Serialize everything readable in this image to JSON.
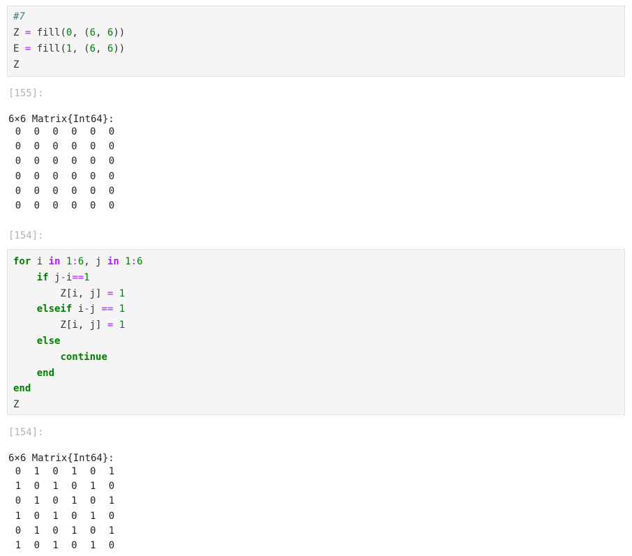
{
  "cells": [
    {
      "code_lines": [
        [
          {
            "t": "#7",
            "c": "comment"
          }
        ],
        [
          {
            "t": "Z ",
            "c": "ident"
          },
          {
            "t": "=",
            "c": "op"
          },
          {
            "t": " fill(",
            "c": "ident"
          },
          {
            "t": "0",
            "c": "num"
          },
          {
            "t": ", (",
            "c": "ident"
          },
          {
            "t": "6",
            "c": "num"
          },
          {
            "t": ", ",
            "c": "ident"
          },
          {
            "t": "6",
            "c": "num"
          },
          {
            "t": "))",
            "c": "ident"
          }
        ],
        [
          {
            "t": "E ",
            "c": "ident"
          },
          {
            "t": "=",
            "c": "op"
          },
          {
            "t": " fill(",
            "c": "ident"
          },
          {
            "t": "1",
            "c": "num"
          },
          {
            "t": ", (",
            "c": "ident"
          },
          {
            "t": "6",
            "c": "num"
          },
          {
            "t": ", ",
            "c": "ident"
          },
          {
            "t": "6",
            "c": "num"
          },
          {
            "t": "))",
            "c": "ident"
          }
        ],
        [
          {
            "t": "Z",
            "c": "ident"
          }
        ]
      ],
      "prompt": "[155]:",
      "output_header": "6×6 Matrix{Int64}:",
      "matrix": [
        [
          "0",
          "0",
          "0",
          "0",
          "0",
          "0"
        ],
        [
          "0",
          "0",
          "0",
          "0",
          "0",
          "0"
        ],
        [
          "0",
          "0",
          "0",
          "0",
          "0",
          "0"
        ],
        [
          "0",
          "0",
          "0",
          "0",
          "0",
          "0"
        ],
        [
          "0",
          "0",
          "0",
          "0",
          "0",
          "0"
        ],
        [
          "0",
          "0",
          "0",
          "0",
          "0",
          "0"
        ]
      ]
    },
    {
      "prompt_in": "[154]:",
      "code_lines": [
        [
          {
            "t": "for",
            "c": "kw"
          },
          {
            "t": " i ",
            "c": "ident"
          },
          {
            "t": "in",
            "c": "kw2"
          },
          {
            "t": " ",
            "c": "ident"
          },
          {
            "t": "1",
            "c": "num"
          },
          {
            "t": ":",
            "c": "op"
          },
          {
            "t": "6",
            "c": "num"
          },
          {
            "t": ", j ",
            "c": "ident"
          },
          {
            "t": "in",
            "c": "kw2"
          },
          {
            "t": " ",
            "c": "ident"
          },
          {
            "t": "1",
            "c": "num"
          },
          {
            "t": ":",
            "c": "op"
          },
          {
            "t": "6",
            "c": "num"
          }
        ],
        [
          {
            "t": "    ",
            "c": "ident"
          },
          {
            "t": "if",
            "c": "kw"
          },
          {
            "t": " j",
            "c": "ident"
          },
          {
            "t": "-",
            "c": "op"
          },
          {
            "t": "i",
            "c": "ident"
          },
          {
            "t": "==",
            "c": "op"
          },
          {
            "t": "1",
            "c": "num"
          }
        ],
        [
          {
            "t": "        Z[i, j] ",
            "c": "ident"
          },
          {
            "t": "=",
            "c": "op"
          },
          {
            "t": " ",
            "c": "ident"
          },
          {
            "t": "1",
            "c": "num"
          }
        ],
        [
          {
            "t": "    ",
            "c": "ident"
          },
          {
            "t": "elseif",
            "c": "kw"
          },
          {
            "t": " i",
            "c": "ident"
          },
          {
            "t": "-",
            "c": "op"
          },
          {
            "t": "j ",
            "c": "ident"
          },
          {
            "t": "==",
            "c": "op"
          },
          {
            "t": " ",
            "c": "ident"
          },
          {
            "t": "1",
            "c": "num"
          }
        ],
        [
          {
            "t": "        Z[i, j] ",
            "c": "ident"
          },
          {
            "t": "=",
            "c": "op"
          },
          {
            "t": " ",
            "c": "ident"
          },
          {
            "t": "1",
            "c": "num"
          }
        ],
        [
          {
            "t": "    ",
            "c": "ident"
          },
          {
            "t": "else",
            "c": "kw"
          }
        ],
        [
          {
            "t": "        ",
            "c": "ident"
          },
          {
            "t": "continue",
            "c": "kw"
          }
        ],
        [
          {
            "t": "    ",
            "c": "ident"
          },
          {
            "t": "end",
            "c": "kw"
          }
        ],
        [
          {
            "t": "end",
            "c": "kw"
          }
        ],
        [
          {
            "t": "Z",
            "c": "ident"
          }
        ]
      ],
      "prompt": "[154]:",
      "output_header": "6×6 Matrix{Int64}:",
      "matrix": [
        [
          "0",
          "1",
          "0",
          "1",
          "0",
          "1"
        ],
        [
          "1",
          "0",
          "1",
          "0",
          "1",
          "0"
        ],
        [
          "0",
          "1",
          "0",
          "1",
          "0",
          "1"
        ],
        [
          "1",
          "0",
          "1",
          "0",
          "1",
          "0"
        ],
        [
          "0",
          "1",
          "0",
          "1",
          "0",
          "1"
        ],
        [
          "1",
          "0",
          "1",
          "0",
          "1",
          "0"
        ]
      ]
    }
  ]
}
